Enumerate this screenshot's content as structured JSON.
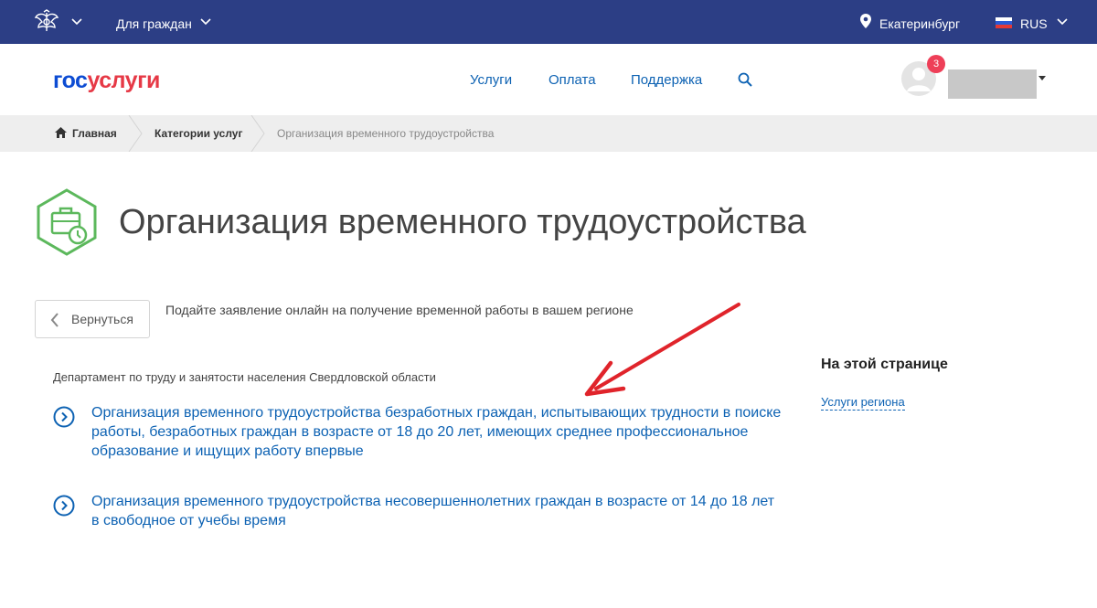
{
  "topbar": {
    "audience_label": "Для граждан",
    "city": "Екатеринбург",
    "language": "RUS"
  },
  "header": {
    "logo_part1": "гос",
    "logo_part2": "услуги",
    "nav": [
      "Услуги",
      "Оплата",
      "Поддержка"
    ],
    "notifications_count": "3"
  },
  "breadcrumbs": {
    "home": "Главная",
    "category": "Категории услуг",
    "current": "Организация временного трудоустройства"
  },
  "page": {
    "title": "Организация временного трудоустройства",
    "back_label": "Вернуться",
    "lead": "Подайте заявление онлайн на получение временной работы в вашем регионе",
    "department": "Департамент по труду и занятости населения Свердловской области",
    "services": [
      {
        "title": "Организация временного трудоустройства безработных граждан, испытывающих трудности в поиске работы, безработных граждан в возрасте от 18 до 20 лет, имеющих среднее профессиональное образование и ищущих работу впервые"
      },
      {
        "title": "Организация временного трудоустройства несовершеннолетних граждан в возрасте от 14 до 18 лет в свободное от учебы время"
      }
    ]
  },
  "sidebar": {
    "title": "На этой странице",
    "link": "Услуги региона"
  },
  "colors": {
    "topbar": "#2c3e85",
    "brand_blue": "#0d4cd3",
    "brand_red": "#e63946",
    "link": "#0d62b3",
    "icon_green": "#5cb85c",
    "annotation_red": "#e0242b"
  }
}
